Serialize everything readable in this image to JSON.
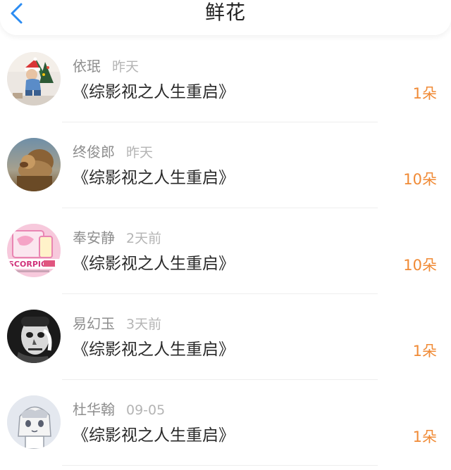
{
  "header": {
    "title": "鲜花"
  },
  "colors": {
    "accent": "#2b8cf2",
    "amount": "#f08a35",
    "name": "#8e8e8e",
    "time": "#b4b4b4"
  },
  "records": [
    {
      "user": "依珉",
      "time": "昨天",
      "book": "《综影视之人生重启》",
      "amount": "1朵"
    },
    {
      "user": "终俊郎",
      "time": "昨天",
      "book": "《综影视之人生重启》",
      "amount": "10朵"
    },
    {
      "user": "奉安静",
      "time": "2天前",
      "book": "《综影视之人生重启》",
      "amount": "10朵"
    },
    {
      "user": "易幻玉",
      "time": "3天前",
      "book": "《综影视之人生重启》",
      "amount": "1朵"
    },
    {
      "user": "杜华翰",
      "time": "09-05",
      "book": "《综影视之人生重启》",
      "amount": "1朵"
    }
  ],
  "avatars": {
    "scorpio_text": "SCORPIO"
  }
}
